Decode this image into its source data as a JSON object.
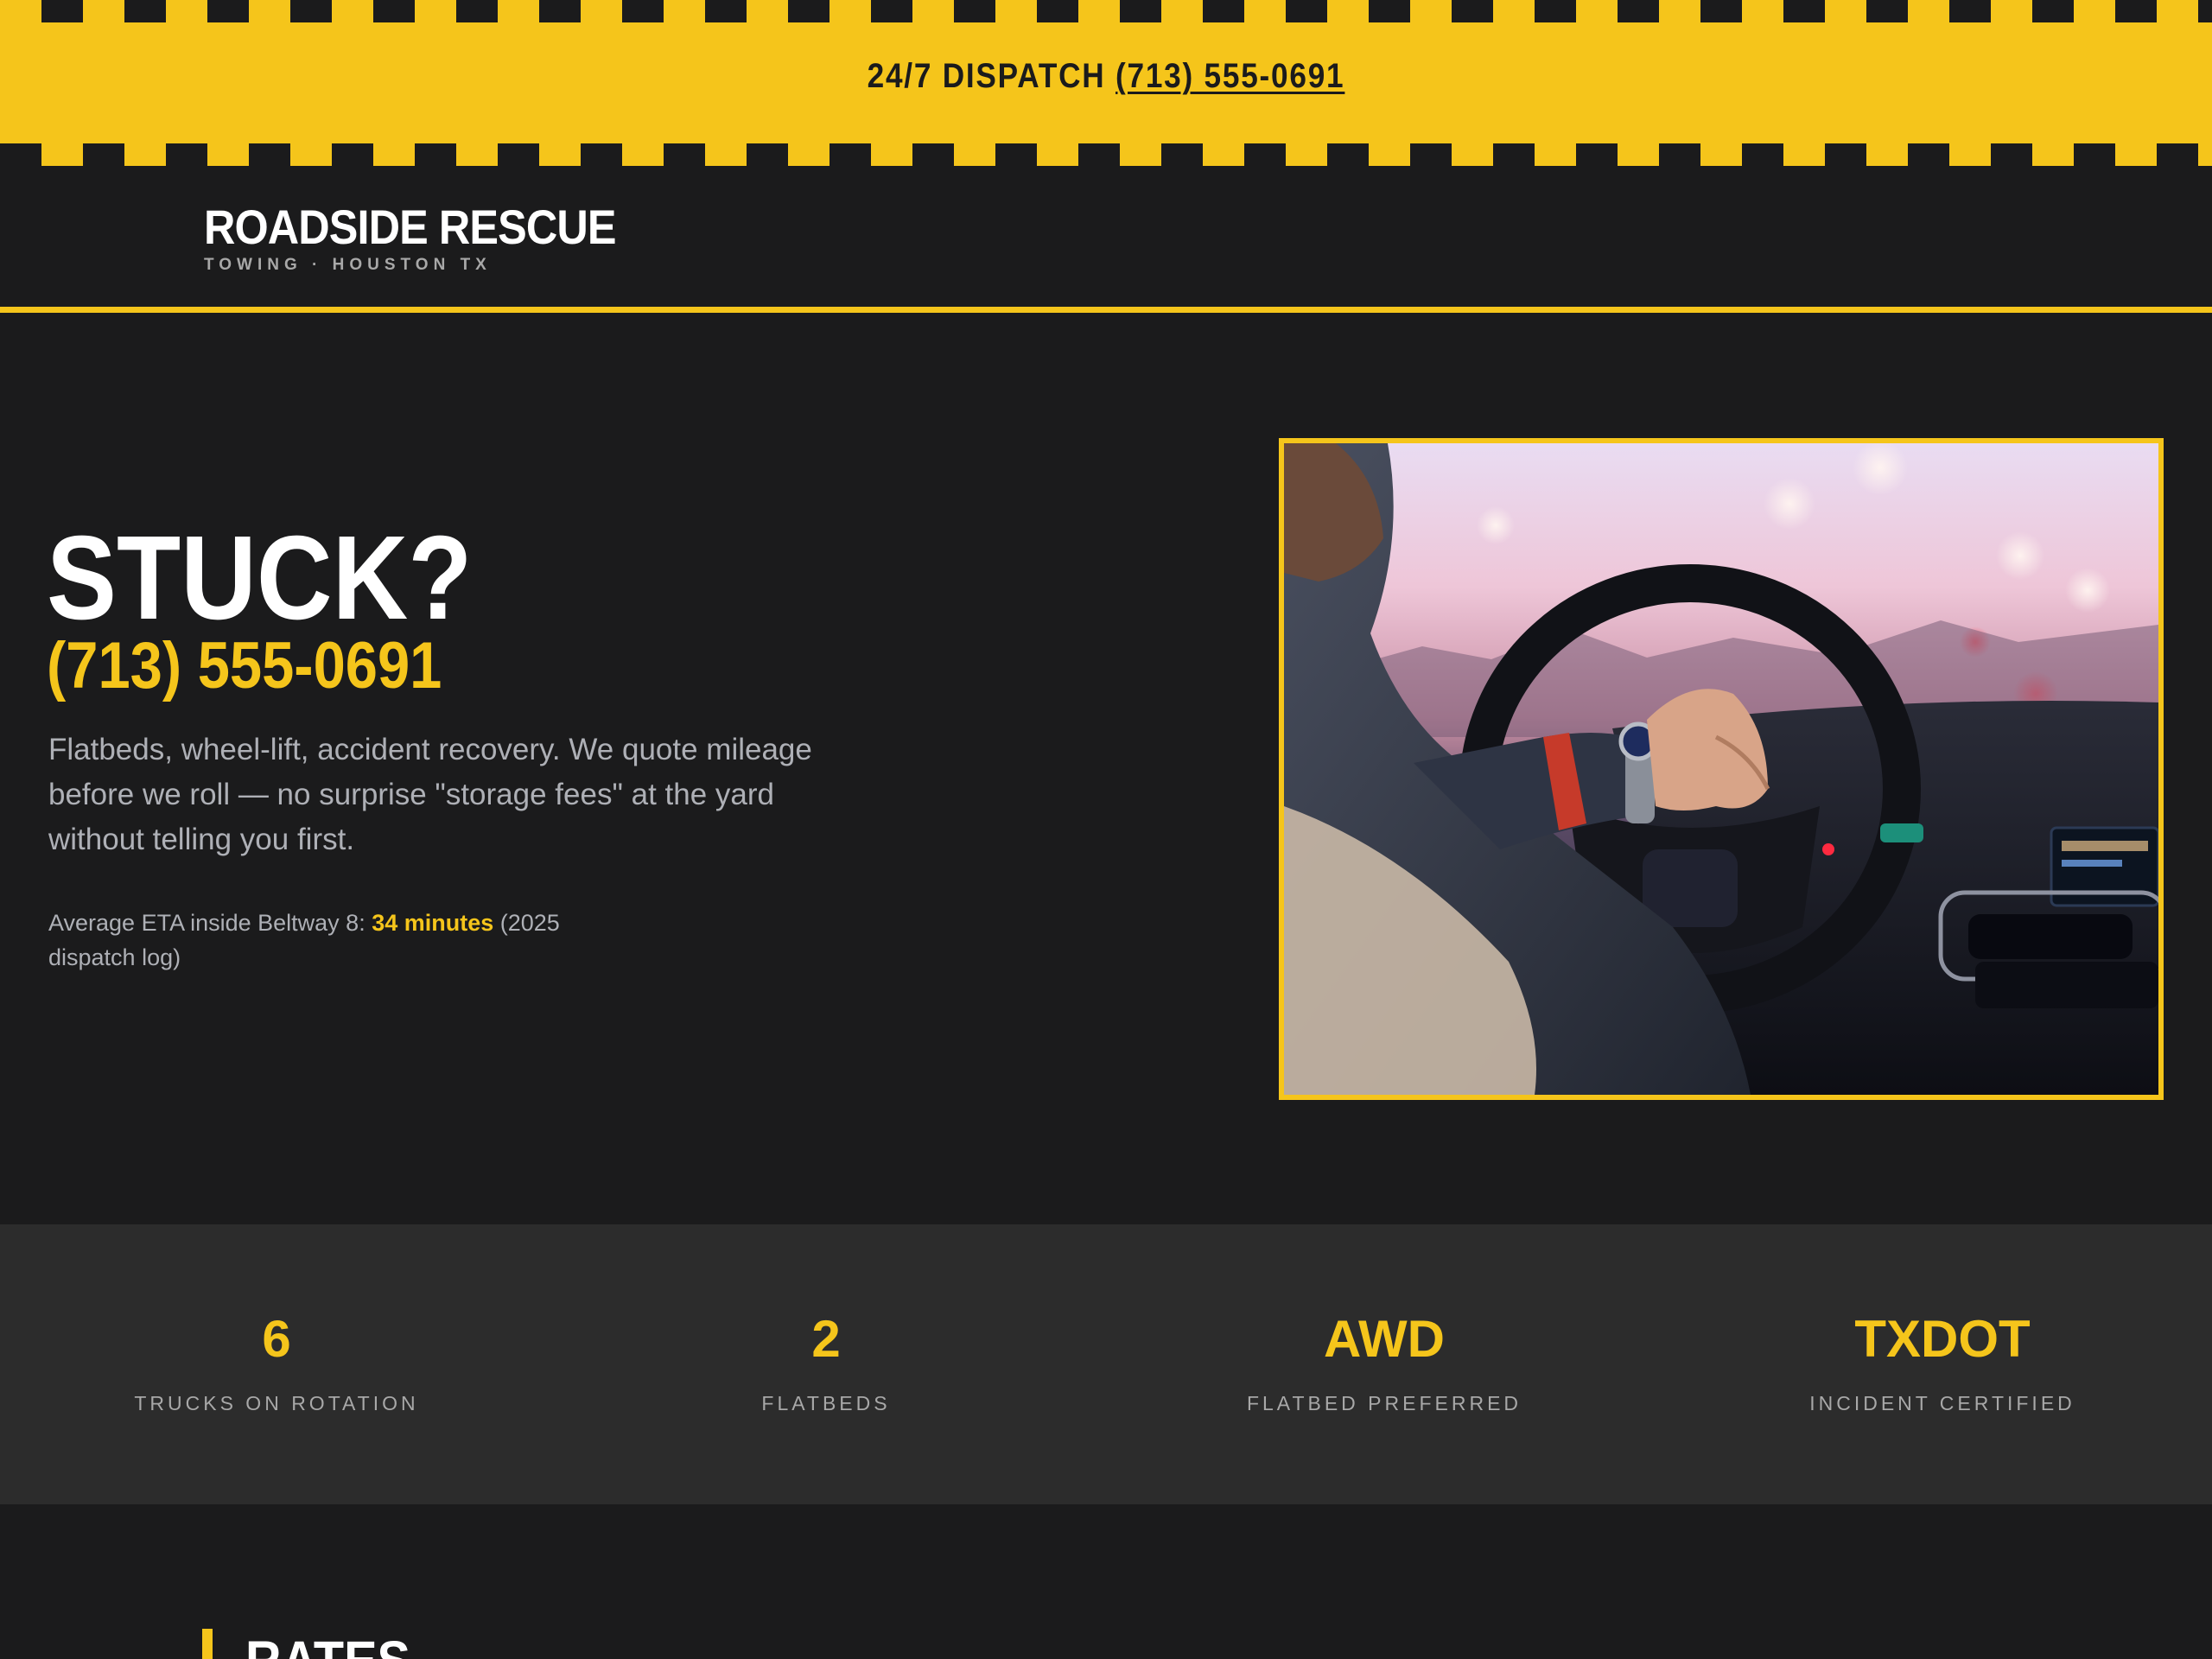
{
  "dispatch_bar": {
    "label": "24/7 DISPATCH",
    "phone": "(713) 555-0691"
  },
  "header": {
    "logo_title": "ROADSIDE RESCUE",
    "logo_subtitle": "TOWING · HOUSTON TX"
  },
  "hero": {
    "title": "STUCK?",
    "phone": "(713) 555-0691",
    "description": "Flatbeds, wheel-lift, accident recovery. We quote mileage before we roll — no surprise \"storage fees\" at the yard without telling you first.",
    "eta_prefix": "Average ETA inside Beltway 8: ",
    "eta_value": "34 minutes",
    "eta_suffix": " (2025 dispatch log)"
  },
  "stats": [
    {
      "value": "6",
      "label": "TRUCKS ON ROTATION"
    },
    {
      "value": "2",
      "label": "FLATBEDS"
    },
    {
      "value": "AWD",
      "label": "FLATBED PREFERRED"
    },
    {
      "value": "TXDOT",
      "label": "INCIDENT CERTIFIED"
    }
  ],
  "rates": {
    "heading": "RATES"
  },
  "colors": {
    "accent_yellow": "#f5c51b",
    "background": "#1b1b1c",
    "stats_band": "#2c2c2c",
    "muted_text": "#aeb0b6"
  }
}
